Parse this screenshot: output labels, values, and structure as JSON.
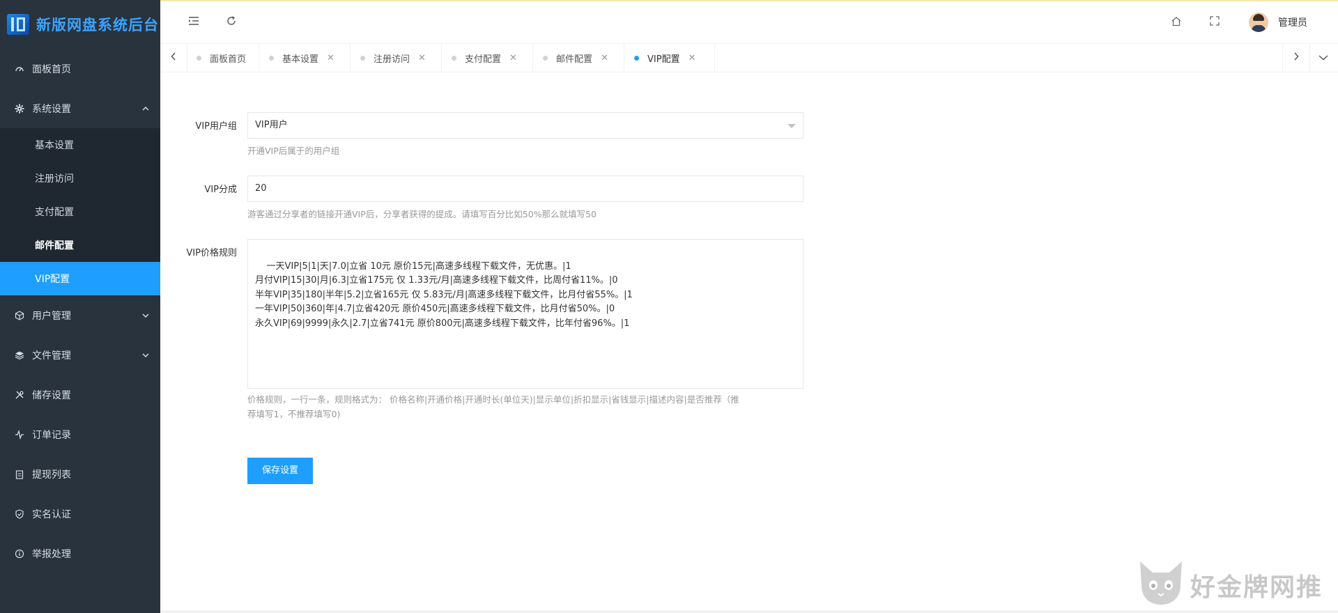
{
  "app": {
    "title": "新版网盘系统后台"
  },
  "sidebar": {
    "items": [
      {
        "label": "面板首页",
        "icon": "dashboard-icon"
      },
      {
        "label": "系统设置",
        "icon": "gear-icon",
        "expanded": true
      },
      {
        "label": "用户管理",
        "icon": "cube-icon"
      },
      {
        "label": "文件管理",
        "icon": "layers-icon"
      },
      {
        "label": "储存设置",
        "icon": "tools-icon"
      },
      {
        "label": "订单记录",
        "icon": "pulse-icon"
      },
      {
        "label": "提现列表",
        "icon": "clipboard-icon"
      },
      {
        "label": "实名认证",
        "icon": "shield-icon"
      },
      {
        "label": "举报处理",
        "icon": "info-icon"
      }
    ],
    "submenu": [
      {
        "label": "基本设置"
      },
      {
        "label": "注册访问"
      },
      {
        "label": "支付配置"
      },
      {
        "label": "邮件配置"
      },
      {
        "label": "VIP配置"
      }
    ]
  },
  "header": {
    "user_name": "管理员"
  },
  "tabs": [
    {
      "label": "面板首页",
      "closable": false
    },
    {
      "label": "基本设置",
      "closable": true
    },
    {
      "label": "注册访问",
      "closable": true
    },
    {
      "label": "支付配置",
      "closable": true
    },
    {
      "label": "邮件配置",
      "closable": true
    },
    {
      "label": "VIP配置",
      "closable": true,
      "active": true
    }
  ],
  "form": {
    "vip_group": {
      "label": "VIP用户组",
      "value": "VIP用户",
      "help": "开通VIP后属于的用户组"
    },
    "vip_share": {
      "label": "VIP分成",
      "value": "20",
      "help": "游客通过分享者的链接开通VIP后，分享者获得的提成。请填写百分比如50%那么就填写50"
    },
    "vip_rules": {
      "label": "VIP价格规则",
      "value": "一天VIP|5|1|天|7.0|立省 10元 原价15元|高速多线程下载文件，无优惠。|1\n月付VIP|15|30|月|6.3|立省175元 仅 1.33元/月|高速多线程下载文件，比周付省11%。|0\n半年VIP|35|180|半年|5.2|立省165元 仅 5.83元/月|高速多线程下载文件，比月付省55%。|1\n一年VIP|50|360|年|4.7|立省420元 原价450元|高速多线程下载文件，比月付省50%。|0\n永久VIP|69|9999|永久|2.7|立省741元 原价800元|高速多线程下载文件，比年付省96%。|1",
      "help_line1": "价格规则，一行一条，规则格式为： 价格名称|开通价格|开通时长(单位天)|显示单位|折扣显示|省钱显示|描述内容|是否推荐（推",
      "help_line2": "荐填写1，不推荐填写0)"
    },
    "save_label": "保存设置"
  },
  "watermark": {
    "text": "好金牌网推"
  },
  "colors": {
    "sidebar_bg": "#28333e",
    "submenu_bg": "#1f2731",
    "accent": "#1e9fff",
    "logo_text": "#3aa3ff"
  }
}
